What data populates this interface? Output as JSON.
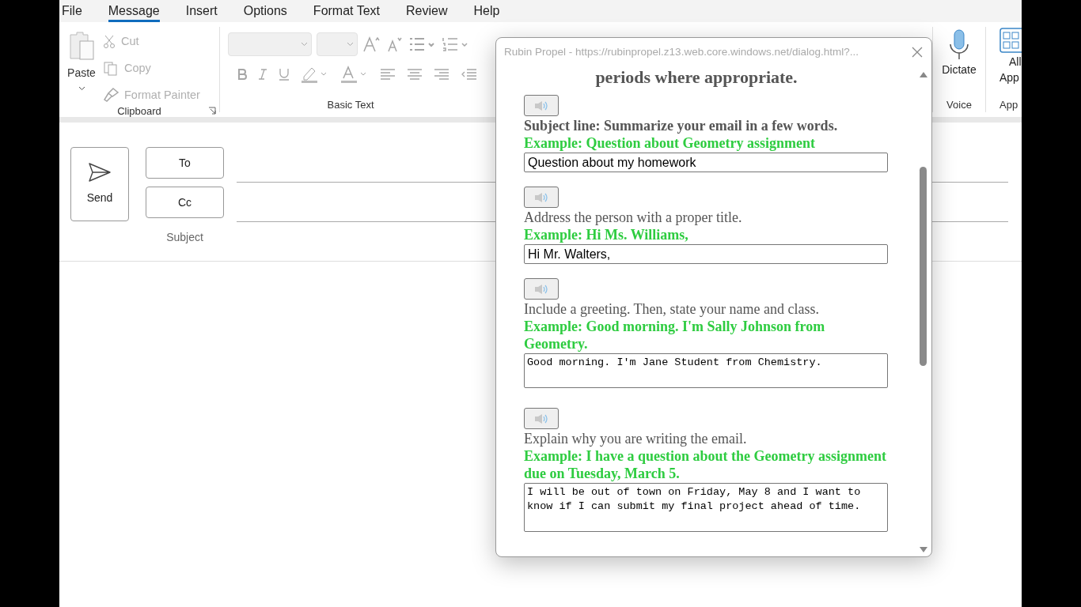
{
  "menu": [
    {
      "label": "File",
      "selected": false
    },
    {
      "label": "Message",
      "selected": true
    },
    {
      "label": "Insert",
      "selected": false
    },
    {
      "label": "Options",
      "selected": false
    },
    {
      "label": "Format Text",
      "selected": false
    },
    {
      "label": "Review",
      "selected": false
    },
    {
      "label": "Help",
      "selected": false
    }
  ],
  "clipboard": {
    "paste": "Paste",
    "cut": "Cut",
    "copy": "Copy",
    "format_painter": "Format Painter",
    "group": "Clipboard"
  },
  "basic_text": {
    "group": "Basic Text"
  },
  "voice": {
    "dictate": "Dictate",
    "group": "Voice"
  },
  "apps": {
    "label_1": "All",
    "label_2": "App",
    "group": "App"
  },
  "compose": {
    "send": "Send",
    "to": "To",
    "cc": "Cc",
    "subject": "Subject"
  },
  "dialog": {
    "title": "Rubin Propel - https://rubinpropel.z13.web.core.windows.net/dialog.html?...",
    "heading": "periods where appropriate.",
    "items": [
      {
        "prompt": "Subject line: Summarize your email in a few words.",
        "bold": true,
        "example": "Example: Question about Geometry assignment",
        "kind": "input",
        "value": "Question about my homework"
      },
      {
        "prompt": "Address the person with a proper title.",
        "bold": false,
        "example": "Example: Hi Ms. Williams,",
        "kind": "input",
        "value": "Hi Mr. Walters,"
      },
      {
        "prompt": "Include a greeting. Then, state your name and class.",
        "bold": false,
        "example": "Example: Good morning. I'm Sally Johnson from Geometry.",
        "kind": "textarea",
        "value": "Good morning. I'm Jane Student from Chemistry."
      },
      {
        "prompt": "Explain why you are writing the email.",
        "bold": false,
        "example": "Example: I have a question about the Geometry assignment due on Tuesday, March 5.",
        "kind": "textarea",
        "value": "I will be out of town on Friday, May 8 and I want to know if I can submit my final project ahead of time."
      }
    ]
  }
}
